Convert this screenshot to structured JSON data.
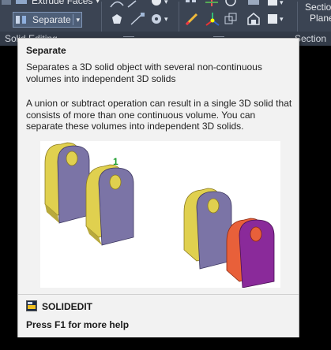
{
  "ribbon": {
    "extrude_faces_label": "Extrude Faces",
    "separate_label": "Separate",
    "section_plane_line1": "Section",
    "section_plane_line2": "Plane",
    "panels": {
      "solid_editing": "Solid Editing",
      "section": "Section"
    }
  },
  "tooltip": {
    "title": "Separate",
    "description": "Separates a 3D solid object with several non-continuous volumes into independent 3D solids",
    "detail": "A union or subtract operation can result in a single 3D solid that consists of more than one continuous volume. You can separate these volumes into independent 3D solids.",
    "illustration_marker": "1",
    "command": "SOLIDEDIT",
    "help": "Press F1 for more help"
  },
  "colors": {
    "ribbon_bg": "#3b4453",
    "tooltip_bg": "#f2f2f2",
    "solid_side": "#d6c84a",
    "solid_face": "#7b74a6",
    "separated_red": "#e8603a",
    "separated_purple": "#8a2a9a",
    "marker_green": "#1a9c2a"
  }
}
